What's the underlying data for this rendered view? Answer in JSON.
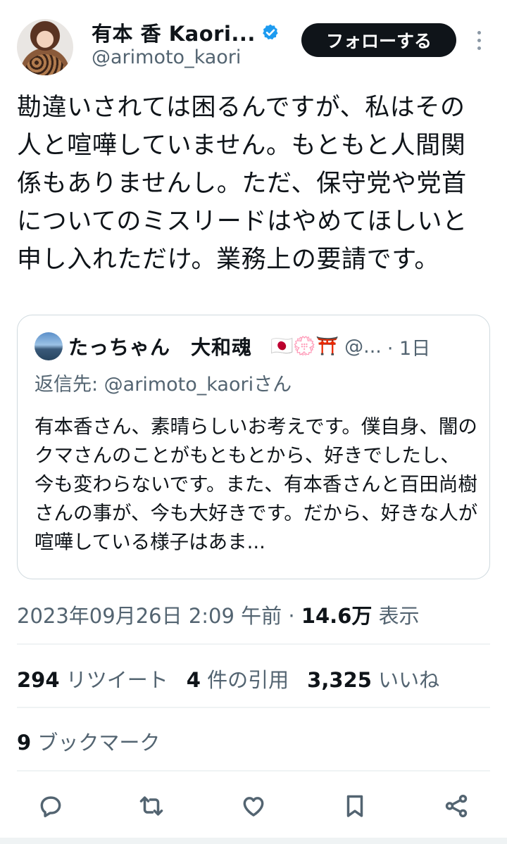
{
  "author": {
    "display_name": "有本 香 Kaori...",
    "handle": "@arimoto_kaori",
    "verified_icon": "verified-badge-icon"
  },
  "follow_label": "フォローする",
  "tweet_text": "勘違いされては困るんですが、私はその人と喧嘩していません。もともと人間関係もありませんし。ただ、保守党や党首についてのミスリードはやめてほしいと申し入れただけ。業務上の要請です。",
  "quote": {
    "name": "たっちゃん　大和魂",
    "emoji": "🇯🇵💮⛩️",
    "handle": "@...",
    "time": "· 1日",
    "reply_to": "返信先: @arimoto_kaoriさん",
    "text": "有本香さん、素晴らしいお考えです。僕自身、闇のクマさんのことがもともとから、好きでしたし、今も変わらないです。また、有本香さんと百田尚樹さんの事が、今も大好きです。だから、好きな人が喧嘩している様子はあま..."
  },
  "meta": {
    "datetime": "2023年09月26日 2:09 午前 · ",
    "views_count": "14.6万",
    "views_label": " 表示"
  },
  "stats": {
    "retweets_count": "294",
    "retweets_label": " リツイート",
    "quotes_count": "4",
    "quotes_label": " 件の引用",
    "likes_count": "3,325",
    "likes_label": " いいね",
    "bookmarks_count": "9",
    "bookmarks_label": " ブックマーク"
  },
  "colors": {
    "text": "#0f1419",
    "secondary": "#536471",
    "border": "#cfd9de",
    "verified": "#1d9bf0"
  },
  "actions": [
    "reply-icon",
    "retweet-icon",
    "like-icon",
    "bookmark-icon",
    "share-icon"
  ]
}
